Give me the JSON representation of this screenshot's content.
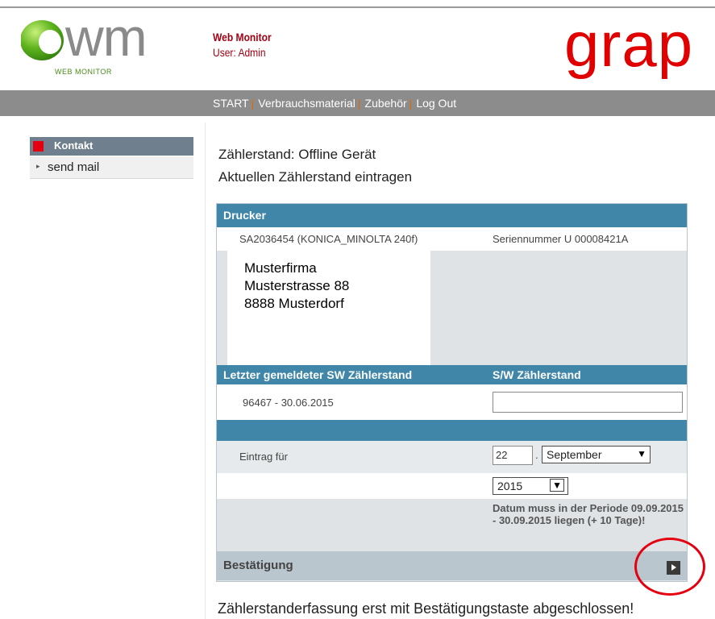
{
  "header": {
    "logo_text": "wm",
    "logo_subtext": "WEB MONITOR",
    "app_title": "Web Monitor",
    "user_label": "User: Admin",
    "brand_text": "grap",
    "brand_color": "#e10000"
  },
  "nav": {
    "items": [
      {
        "label": "START"
      },
      {
        "label": "Verbrauchsmaterial"
      },
      {
        "label": "Zubehör"
      },
      {
        "label": "Log Out"
      }
    ],
    "separator": "|"
  },
  "sidebar": {
    "section_title": "Kontakt",
    "items": [
      {
        "label": "send mail"
      }
    ]
  },
  "main": {
    "heading1": "Zählerstand: Offline Gerät",
    "heading2": "Aktuellen Zählerstand eintragen",
    "printer_header": "Drucker",
    "device_name": "SA2036454 (KONICA_MINOLTA 240f)",
    "serial_number": "Seriennummer U 00008421A",
    "address_lines": [
      "Musterfirma",
      "Musterstrasse 88",
      "8888 Musterdorf"
    ],
    "last_reading_header": "Letzter gemeldeter SW Zählerstand",
    "sw_reading_header": "S/W Zählerstand",
    "last_reading_value": "96467  -  30.06.2015",
    "sw_reading_input": "",
    "entry_label": "Eintrag für",
    "day_value": "22",
    "date_separator": ".",
    "month_value": "September",
    "year_value": "2015",
    "date_note": "Datum muss in der Periode 09.09.2015 - 30.09.2015 liegen (+ 10 Tage)!",
    "confirm_label": "Bestätigung",
    "footer_message": "Zählerstanderfassung erst mit Bestätigungstaste abgeschlossen!"
  },
  "colors": {
    "accent_blue": "#3f86a8",
    "nav_gray": "#8c8c8c",
    "highlight_red": "#e4000f"
  }
}
